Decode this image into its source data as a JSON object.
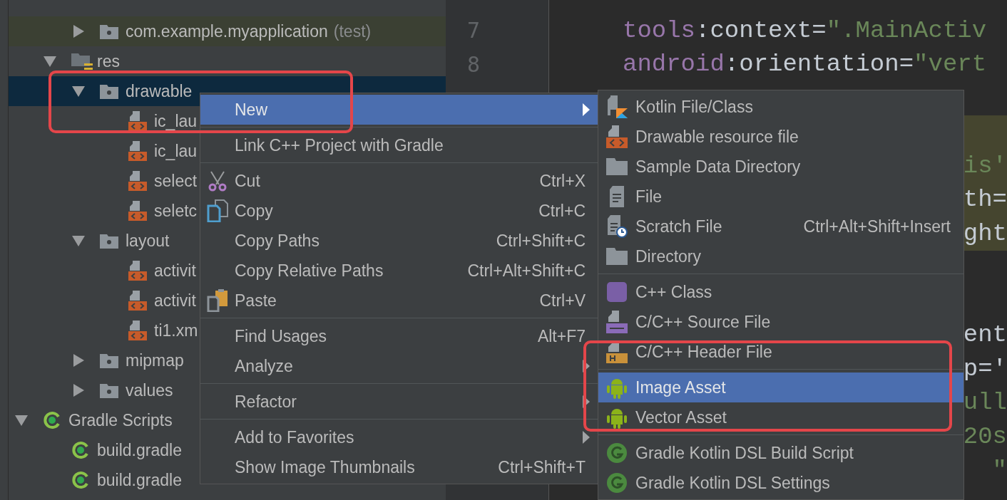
{
  "tree": [
    {
      "children": [
        {
          "children": [
            {
              "label": "com.example.myapplication",
              "suffix": "(test)",
              "kind": "folder",
              "expanded": false,
              "selected": false,
              "tinted": true
            }
          ]
        },
        {
          "label": "res",
          "kind": "res_folder",
          "expanded": true,
          "selected": false,
          "children": [
            {
              "label": "drawable",
              "kind": "folder",
              "expanded": true,
              "selected": true,
              "children": [
                {
                  "label": "ic_lau",
                  "kind": "xml_file",
                  "selected": false
                },
                {
                  "label": "ic_lau",
                  "kind": "xml_file",
                  "selected": false
                },
                {
                  "label": "select",
                  "kind": "xml_file",
                  "selected": false
                },
                {
                  "label": "seletc",
                  "kind": "xml_file",
                  "selected": false
                }
              ]
            },
            {
              "label": "layout",
              "kind": "folder",
              "expanded": true,
              "selected": false,
              "children": [
                {
                  "label": "activit",
                  "kind": "xml_file",
                  "selected": false
                },
                {
                  "label": "activit",
                  "kind": "xml_file",
                  "selected": false
                },
                {
                  "label": "ti1.xm",
                  "kind": "xml_file",
                  "selected": false
                }
              ]
            },
            {
              "label": "mipmap",
              "kind": "folder",
              "expanded": false,
              "selected": false
            },
            {
              "label": "values",
              "kind": "folder",
              "expanded": false,
              "selected": false
            }
          ]
        }
      ]
    },
    {
      "label": "Gradle Scripts",
      "kind": "gradle",
      "expanded": true,
      "selected": false,
      "children": [
        {
          "label": "build.gradle",
          "kind": "gradle",
          "selected": false
        },
        {
          "label": "build.gradle",
          "kind": "gradle",
          "selected": false
        }
      ]
    }
  ],
  "editor": {
    "lines": [
      {
        "number": "7",
        "highlighted": false,
        "tokens": [
          {
            "text": "tools",
            "kind": "ns"
          },
          {
            "text": ":context=",
            "kind": "plain"
          },
          {
            "text": "\".MainActiv",
            "kind": "string"
          }
        ]
      },
      {
        "number": "8",
        "highlighted": false,
        "tokens": [
          {
            "text": "android",
            "kind": "ns"
          },
          {
            "text": ":orientation=",
            "kind": "plain"
          },
          {
            "text": "\"vert",
            "kind": "string"
          }
        ]
      },
      {
        "highlighted": false
      },
      {
        "highlighted": true
      },
      {
        "highlighted": true,
        "tokens": [
          {
            "text": "is'",
            "kind": "string"
          }
        ]
      },
      {
        "highlighted": true,
        "tokens": [
          {
            "text": "th=",
            "kind": "plain"
          }
        ]
      },
      {
        "highlighted": true,
        "tokens": [
          {
            "text": "ght",
            "kind": "plain"
          }
        ]
      },
      {
        "highlighted": false
      },
      {
        "highlighted": false
      },
      {
        "highlighted": false,
        "tokens": [
          {
            "text": "ent",
            "kind": "plain"
          }
        ]
      },
      {
        "highlighted": false,
        "tokens": [
          {
            "text": "p='",
            "kind": "plain"
          }
        ]
      },
      {
        "highlighted": false,
        "tokens": [
          {
            "text": "ull",
            "kind": "string"
          }
        ]
      },
      {
        "highlighted": false,
        "tokens": [
          {
            "text": "20s",
            "kind": "string"
          }
        ]
      },
      {
        "highlighted": false,
        "tokens": [
          {
            "text": "\"",
            "kind": "string"
          }
        ]
      }
    ]
  },
  "context_menu": {
    "groups": [
      [
        {
          "label": "New",
          "selected": true,
          "submenu": true
        }
      ],
      [
        {
          "label": "Link C++ Project with Gradle",
          "selected": false,
          "submenu": false
        }
      ],
      [
        {
          "label": "Cut",
          "shortcut": "Ctrl+X",
          "kind": "cut",
          "selected": false,
          "submenu": false
        },
        {
          "label": "Copy",
          "shortcut": "Ctrl+C",
          "kind": "copy",
          "selected": false,
          "submenu": false
        },
        {
          "label": "Copy Paths",
          "shortcut": "Ctrl+Shift+C",
          "selected": false,
          "submenu": false
        },
        {
          "label": "Copy Relative Paths",
          "shortcut": "Ctrl+Alt+Shift+C",
          "selected": false,
          "submenu": false
        },
        {
          "label": "Paste",
          "shortcut": "Ctrl+V",
          "kind": "paste",
          "selected": false,
          "submenu": false
        }
      ],
      [
        {
          "label": "Find Usages",
          "shortcut": "Alt+F7",
          "selected": false,
          "submenu": false
        },
        {
          "label": "Analyze",
          "selected": false,
          "submenu": true
        }
      ],
      [
        {
          "label": "Refactor",
          "selected": false,
          "submenu": true
        }
      ],
      [
        {
          "label": "Add to Favorites",
          "selected": false,
          "submenu": true
        },
        {
          "label": "Show Image Thumbnails",
          "shortcut": "Ctrl+Shift+T",
          "selected": false,
          "submenu": false
        }
      ]
    ]
  },
  "new_submenu": {
    "groups": [
      [
        {
          "label": "Kotlin File/Class",
          "kind": "kotlin",
          "selected": false
        },
        {
          "label": "Drawable resource file",
          "kind": "resource",
          "selected": false
        },
        {
          "label": "Sample Data Directory",
          "kind": "folder",
          "selected": false
        },
        {
          "label": "File",
          "kind": "file",
          "selected": false
        },
        {
          "label": "Scratch File",
          "shortcut": "Ctrl+Alt+Shift+Insert",
          "kind": "scratch",
          "selected": false
        },
        {
          "label": "Directory",
          "kind": "folder",
          "selected": false
        }
      ],
      [
        {
          "label": "C++ Class",
          "kind": "cpp_class",
          "selected": false
        },
        {
          "label": "C/C++ Source File",
          "kind": "cpp_source",
          "selected": false
        },
        {
          "label": "C/C++ Header File",
          "kind": "header",
          "selected": false
        }
      ],
      [
        {
          "label": "Image Asset",
          "kind": "asset",
          "selected": true
        },
        {
          "label": "Vector Asset",
          "kind": "asset",
          "selected": false
        }
      ],
      [
        {
          "label": "Gradle Kotlin DSL Build Script",
          "kind": "gradle",
          "selected": false
        },
        {
          "label": "Gradle Kotlin DSL Settings",
          "kind": "gradle",
          "selected": false
        }
      ]
    ]
  }
}
